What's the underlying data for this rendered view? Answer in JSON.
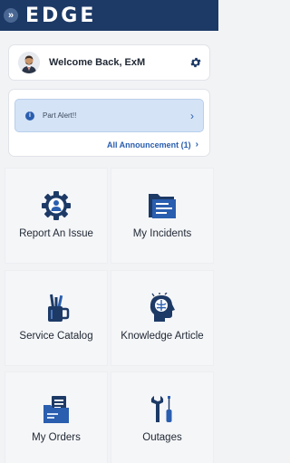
{
  "header": {
    "logo_text": "EDGE",
    "expand_glyph": "»"
  },
  "welcome": {
    "text": "Welcome Back, ExM",
    "settings_icon": "gear-icon"
  },
  "announcements": {
    "alert_icon_glyph": "i",
    "alert_text": "Part Alert!!",
    "alert_chevron": "›",
    "all_label": "All Announcement (1)",
    "all_chevron": "›"
  },
  "tiles": [
    {
      "label": "Report An Issue",
      "icon": "gear-person-icon"
    },
    {
      "label": "My Incidents",
      "icon": "folder-icon"
    },
    {
      "label": "Service Catalog",
      "icon": "pen-cup-icon"
    },
    {
      "label": "Knowledge Article",
      "icon": "head-brain-icon"
    },
    {
      "label": "My Orders",
      "icon": "orders-icon"
    },
    {
      "label": "Outages",
      "icon": "tools-icon"
    }
  ],
  "colors": {
    "brand_navy": "#1d3a66",
    "accent_blue": "#2a5eaf",
    "alert_bg": "#d4e3f6"
  }
}
